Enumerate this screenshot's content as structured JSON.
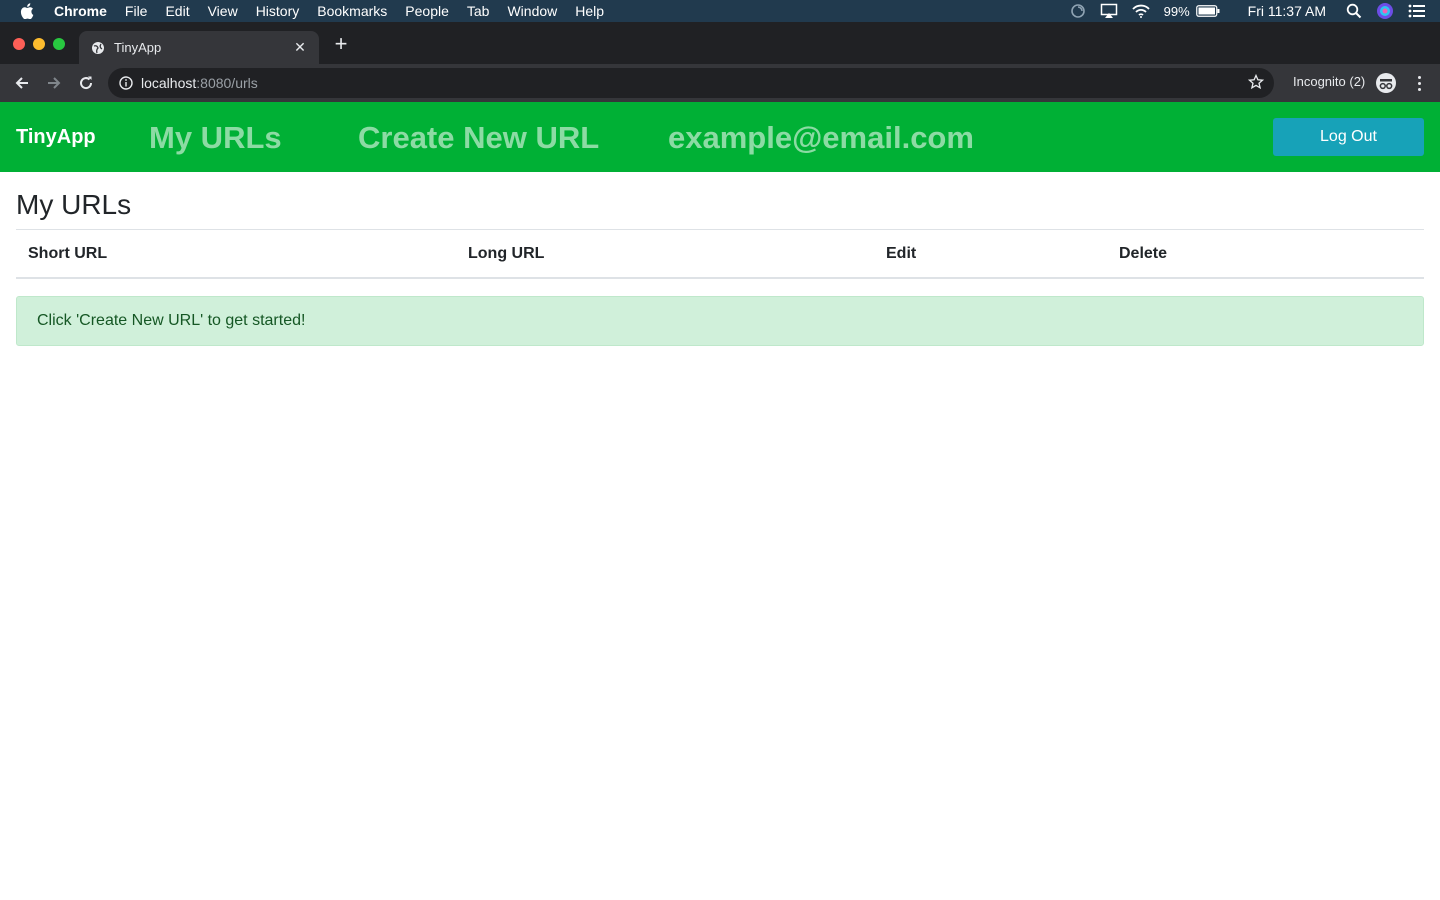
{
  "menubar": {
    "items": [
      "Chrome",
      "File",
      "Edit",
      "View",
      "History",
      "Bookmarks",
      "People",
      "Tab",
      "Window",
      "Help"
    ],
    "battery": "99%",
    "clock": "Fri 11:37 AM"
  },
  "browser": {
    "tab_title": "TinyApp",
    "url_host": "localhost",
    "url_rest": ":8080/urls",
    "profile_label": "Incognito (2)"
  },
  "navbar": {
    "brand": "TinyApp",
    "links": [
      "My URLs",
      "Create New URL",
      "example@email.com"
    ],
    "logout_label": "Log Out",
    "bg_color": "#00b035",
    "button_color": "#17a2b8"
  },
  "main": {
    "title": "My URLs",
    "table_headers": [
      "Short URL",
      "Long URL",
      "Edit",
      "Delete"
    ],
    "alert": "Click 'Create New URL' to get started!"
  }
}
